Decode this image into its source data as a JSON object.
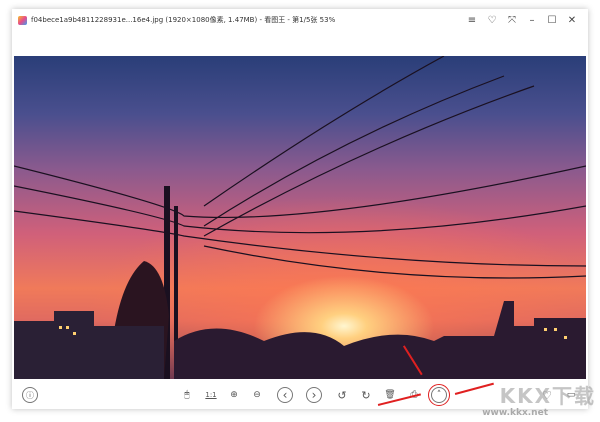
{
  "window": {
    "title": "f04bece1a9b4811228931e...16e4.jpg  (1920×1080像素, 1.47MB) - 看图王 - 第1/5张 53%",
    "controls": [
      "menu-icon",
      "skin-icon",
      "fullscreen-icon",
      "minimize-icon",
      "maximize-icon",
      "close-icon"
    ]
  },
  "toolbar": {
    "info": "ⓘ",
    "mouse": "🖱",
    "actual_size": "1:1",
    "zoom_in": "⊕",
    "zoom_out": "⊖",
    "prev": "‹",
    "next": "›",
    "rotate_left": "↺",
    "rotate_right": "↻",
    "delete": "🗑",
    "print": "⎙",
    "more": "˄",
    "favorite": "♡",
    "folder": "▭"
  },
  "watermark": {
    "logo": "KKX下载",
    "url": "www.kkx.net"
  },
  "colors": {
    "highlight": "#e02020"
  }
}
